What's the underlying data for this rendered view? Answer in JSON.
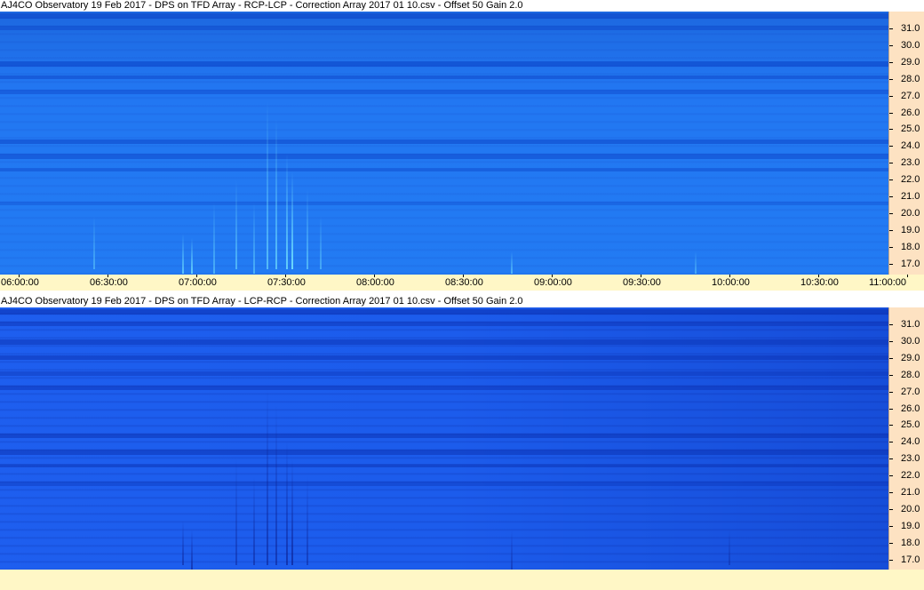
{
  "window": {
    "top_title": "AJ4CO Observatory 19 Feb 2017  -  DPS on TFD Array  -  RCP-LCP  -  Correction Array 2017 01 10.csv  -  Offset 50  Gain 2.0",
    "bottom_title": "AJ4CO Observatory 19 Feb 2017  -  DPS on TFD Array  -  LCP-RCP  -  Correction Array 2017 01 10.csv  -  Offset 50  Gain 2.0"
  },
  "y_axis": {
    "labels": [
      "31.0",
      "30.0",
      "29.0",
      "28.0",
      "27.0",
      "26.0",
      "25.0",
      "24.0",
      "23.0",
      "22.0",
      "21.0",
      "20.0",
      "19.0",
      "18.0",
      "17.0"
    ]
  },
  "x_axis": {
    "labels": [
      "06:00:00",
      "06:30:00",
      "07:00:00",
      "07:30:00",
      "08:00:00",
      "08:30:00",
      "09:00:00",
      "09:30:00",
      "10:00:00",
      "10:30:00",
      "11:00:00"
    ]
  },
  "colors": {
    "top_panel": "#2277f2",
    "bottom_panel": "#1c5cec",
    "y_axis_bg": "#fde2c2",
    "x_axis_bg": "#fff7c6"
  }
}
